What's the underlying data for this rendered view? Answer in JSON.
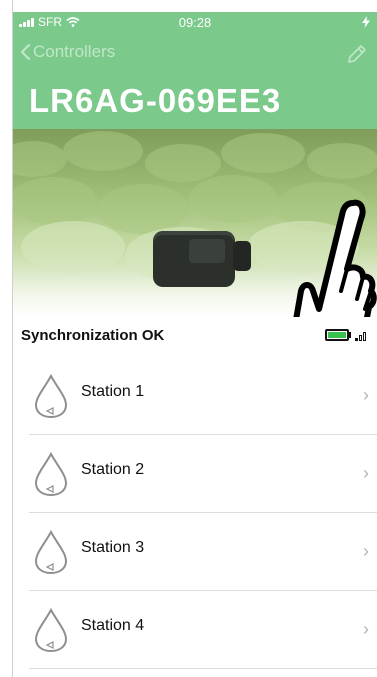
{
  "status_bar": {
    "carrier": "SFR",
    "time": "09:28"
  },
  "nav": {
    "back_label": "Controllers"
  },
  "controller": {
    "name": "LR6AG-069EE3"
  },
  "sync": {
    "label": "Synchronization OK",
    "battery_color": "#39c24f"
  },
  "stations": [
    {
      "name": "Station 1"
    },
    {
      "name": "Station 2"
    },
    {
      "name": "Station 3"
    },
    {
      "name": "Station 4"
    }
  ],
  "colors": {
    "header": "#7bc98b",
    "title": "#ffffff"
  },
  "icons": [
    "wifi-icon",
    "signal-bars-icon",
    "charging-battery-icon",
    "back-chevron-icon",
    "edit-pencil-icon",
    "water-drop-icon",
    "chevron-right-icon"
  ]
}
